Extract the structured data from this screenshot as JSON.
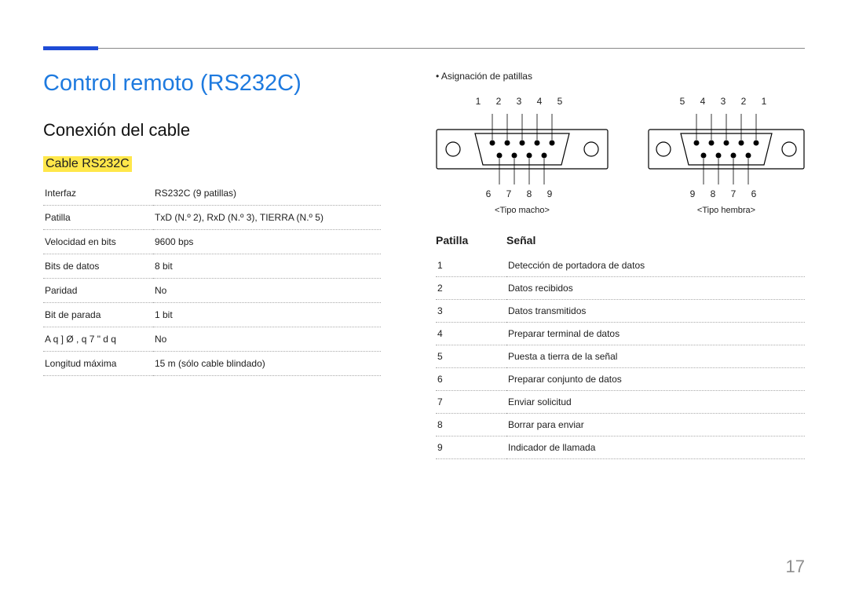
{
  "heading_main": "Control remoto (RS232C)",
  "heading_sub": "Conexión del cable",
  "heading_cable": "Cable RS232C",
  "spec_rows": [
    {
      "k": "Interfaz",
      "v": "RS232C (9 patillas)"
    },
    {
      "k": "Patilla",
      "v": "TxD (N.º 2), RxD (N.º 3), TIERRA (N.º 5)"
    },
    {
      "k": "Velocidad en bits",
      "v": "9600 bps"
    },
    {
      "k": "Bits de datos",
      "v": "8 bit"
    },
    {
      "k": "Paridad",
      "v": "No"
    },
    {
      "k": "Bit de parada",
      "v": "1 bit"
    },
    {
      "k": "A q ] Ø , q 7    \"    d    q",
      "v": "No"
    },
    {
      "k": "Longitud máxima",
      "v": "15 m (sólo cable blindado)"
    }
  ],
  "bullet_text": "Asignación de patillas",
  "conn_male": {
    "top_pins": "1 2 3 4 5",
    "bottom_pins": "6 7 8 9",
    "label": "<Tipo macho>"
  },
  "conn_female": {
    "top_pins": "5 4 3 2 1",
    "bottom_pins": "9 8 7 6",
    "label": "<Tipo hembra>"
  },
  "sig_headers": {
    "pin": "Patilla",
    "signal": "Señal"
  },
  "signals": [
    {
      "p": "1",
      "s": "Detección de portadora de datos"
    },
    {
      "p": "2",
      "s": "Datos recibidos"
    },
    {
      "p": "3",
      "s": "Datos transmitidos"
    },
    {
      "p": "4",
      "s": "Preparar terminal de datos"
    },
    {
      "p": "5",
      "s": "Puesta a tierra de la señal"
    },
    {
      "p": "6",
      "s": "Preparar conjunto de datos"
    },
    {
      "p": "7",
      "s": "Enviar solicitud"
    },
    {
      "p": "8",
      "s": "Borrar para enviar"
    },
    {
      "p": "9",
      "s": "Indicador de llamada"
    }
  ],
  "page_number": "17"
}
